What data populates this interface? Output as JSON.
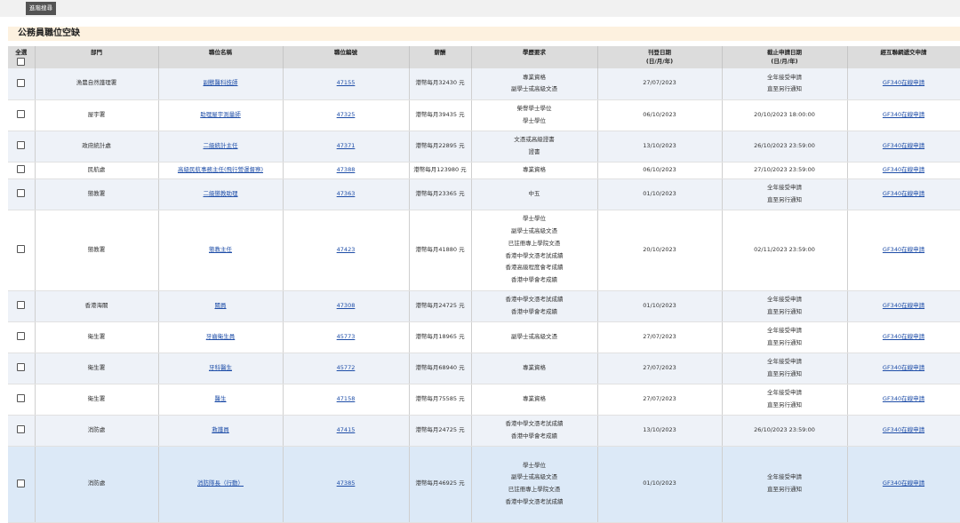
{
  "toolbar": {
    "advanced_search_label": "進階搜尋"
  },
  "page_title": "公務員職位空缺",
  "table": {
    "headers": {
      "select_all": "全選",
      "department": "部門",
      "job_title": "職位名稱",
      "job_ref": "職位編號",
      "salary": "薪酬",
      "qualification": "學歷要求",
      "publish_date": "刊登日期",
      "publish_date_fmt": "(日/月/年)",
      "closing_date": "截止申請日期",
      "closing_date_fmt": "(日/月/年)",
      "apply": "經互聯網遞交申請"
    },
    "rows": [
      {
        "department": "漁農自然護理署",
        "job_title": "副獸醫科技師",
        "job_ref": "47155",
        "salary": "港幣每月32430 元",
        "qualifications": [
          "專業資格",
          "副學士或高級文憑"
        ],
        "publish_date": "27/07/2023",
        "closing_date": [
          "全年接受申請",
          "直至另行通知"
        ],
        "apply": "GF340在線申請"
      },
      {
        "department": "屋宇署",
        "job_title": "助理屋宇測量師",
        "job_ref": "47325",
        "salary": "港幣每月39435 元",
        "qualifications": [
          "榮譽學士學位",
          "學士學位"
        ],
        "publish_date": "06/10/2023",
        "closing_date": [
          "20/10/2023 18:00:00"
        ],
        "apply": "GF340在線申請"
      },
      {
        "department": "政府統計處",
        "job_title": "二級統計主任",
        "job_ref": "47371",
        "salary": "港幣每月22895 元",
        "qualifications": [
          "文憑或高級證書",
          "證書"
        ],
        "publish_date": "13/10/2023",
        "closing_date": [
          "26/10/2023 23:59:00"
        ],
        "apply": "GF340在線申請"
      },
      {
        "department": "民航處",
        "job_title": "高級民航事務主任(飛行營運督察)",
        "job_ref": "47388",
        "salary": "港幣每月123980 元",
        "qualifications": [
          "專業資格"
        ],
        "publish_date": "06/10/2023",
        "closing_date": [
          "27/10/2023 23:59:00"
        ],
        "apply": "GF340在線申請"
      },
      {
        "department": "懲教署",
        "job_title": "二級懲教助理",
        "job_ref": "47363",
        "salary": "港幣每月23365 元",
        "qualifications": [
          "中五"
        ],
        "publish_date": "01/10/2023",
        "closing_date": [
          "全年接受申請",
          "直至另行通知"
        ],
        "apply": "GF340在線申請"
      },
      {
        "department": "懲教署",
        "job_title": "懲教主任",
        "job_ref": "47423",
        "salary": "港幣每月41880 元",
        "qualifications": [
          "學士學位",
          "副學士或高級文憑",
          "已註冊專上學院文憑",
          "香港中學文憑考試成績",
          "香港高級程度會考成績",
          "香港中學會考成績"
        ],
        "publish_date": "20/10/2023",
        "closing_date": [
          "02/11/2023 23:59:00"
        ],
        "apply": "GF340在線申請"
      },
      {
        "department": "香港海關",
        "job_title": "關員",
        "job_ref": "47308",
        "salary": "港幣每月24725 元",
        "qualifications": [
          "香港中學文憑考試成績",
          "香港中學會考成績"
        ],
        "publish_date": "01/10/2023",
        "closing_date": [
          "全年接受申請",
          "直至另行通知"
        ],
        "apply": "GF340在線申請"
      },
      {
        "department": "衛生署",
        "job_title": "牙齒衛生員",
        "job_ref": "45773",
        "salary": "港幣每月18965 元",
        "qualifications": [
          "副學士或高級文憑"
        ],
        "publish_date": "27/07/2023",
        "closing_date": [
          "全年接受申請",
          "直至另行通知"
        ],
        "apply": "GF340在線申請"
      },
      {
        "department": "衛生署",
        "job_title": "牙科醫生",
        "job_ref": "45772",
        "salary": "港幣每月68940 元",
        "qualifications": [
          "專業資格"
        ],
        "publish_date": "27/07/2023",
        "closing_date": [
          "全年接受申請",
          "直至另行通知"
        ],
        "apply": "GF340在線申請"
      },
      {
        "department": "衛生署",
        "job_title": "醫生",
        "job_ref": "47158",
        "salary": "港幣每月75585 元",
        "qualifications": [
          "專業資格"
        ],
        "publish_date": "27/07/2023",
        "closing_date": [
          "全年接受申請",
          "直至另行通知"
        ],
        "apply": "GF340在線申請"
      },
      {
        "department": "消防處",
        "job_title": "救護員",
        "job_ref": "47415",
        "salary": "港幣每月24725 元",
        "qualifications": [
          "香港中學文憑考試成績",
          "香港中學會考成績"
        ],
        "publish_date": "13/10/2023",
        "closing_date": [
          "26/10/2023 23:59:00"
        ],
        "apply": "GF340在線申請"
      },
      {
        "department": "消防處",
        "job_title": "消防隊長（行動）",
        "job_ref": "47385",
        "salary": "港幣每月46925 元",
        "qualifications": [
          "學士學位",
          "副學士或高級文憑",
          "已註冊專上學院文憑",
          "香港中學文憑考試成績"
        ],
        "publish_date": "01/10/2023",
        "closing_date": [
          "全年接受申請",
          "直至另行通知"
        ],
        "apply": "GF340在線申請"
      }
    ]
  }
}
